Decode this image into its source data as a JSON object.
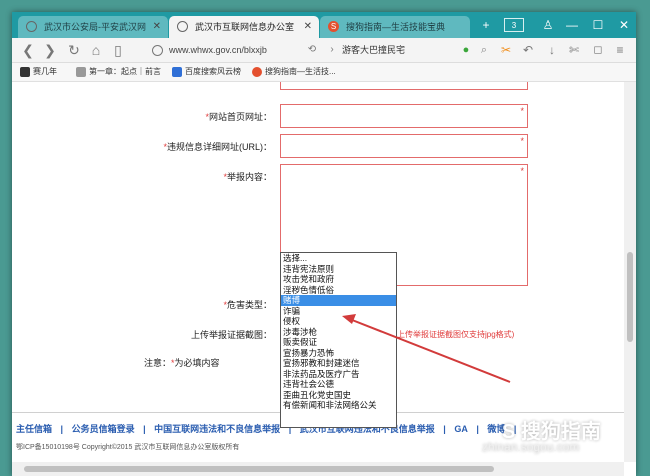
{
  "tabs": [
    {
      "label": "武汉市公安局-平安武汉网"
    },
    {
      "label": "武汉市互联网信息办公室"
    },
    {
      "label": "搜狗指南—生活技能宝典"
    }
  ],
  "window": {
    "tab_count": "3"
  },
  "nav": {
    "url": "www.whwx.gov.cn/blxxjb",
    "search_text": "游客大巴撞民宅"
  },
  "bookmarks": [
    {
      "label": "赛几年"
    },
    {
      "label": "第一章：起点｜前言"
    },
    {
      "label": "百度搜索风云榜"
    },
    {
      "label": "搜狗指南—生活技..."
    }
  ],
  "form": {
    "site_url_label": "网站首页网址：",
    "violation_url_label": "违规信息详细网址(URL)：",
    "content_label": "举报内容：",
    "harm_type_label": "危害类型：",
    "upload_label": "上传举报证据截图：",
    "upload_hint": "上传举报证据截图仅支持jpg格式)",
    "note_label": "注意：",
    "note_text": "为必填内容",
    "star": "*"
  },
  "dropdown": {
    "options": [
      "选择...",
      "违背宪法原则",
      "攻击党和政府",
      "淫秽色情低俗",
      "赌博",
      "诈骗",
      "侵权",
      "涉毒涉枪",
      "贩卖假证",
      "宣扬暴力恐怖",
      "宣扬邪教和封建迷信",
      "非法药品及医疗广告",
      "违背社会公德",
      "歪曲丑化党史国史",
      "有偿新闻和非法网络公关"
    ],
    "selected": "赌博"
  },
  "footer": {
    "links": [
      "主任信箱",
      "|",
      "公务员信箱登录",
      "|",
      "中国互联网违法和不良信息举报",
      "|",
      "武汉市互联网违法和不良信息举报",
      "|",
      "GA",
      "|",
      "微博",
      "|"
    ],
    "copyright": "鄂ICP备15010198号  Copyright©2015 武汉市互联网信息办公室版权所有"
  },
  "watermark": {
    "brand": "搜狗指南",
    "domain": "zhinan.sogou.com"
  },
  "colors": {
    "titlebar": "#1f9aa3",
    "required": "#e03c3c",
    "link": "#2a5db0",
    "selected": "#3a8ee6",
    "arrow": "#d23b3b"
  }
}
